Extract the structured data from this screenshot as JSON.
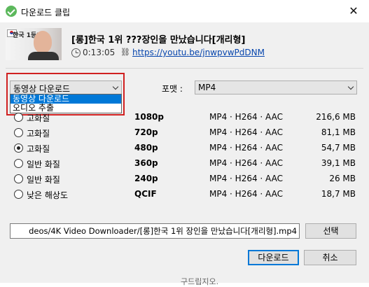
{
  "window": {
    "title": "다운로드 클립",
    "close": "✕"
  },
  "video": {
    "thumbnail_caption": "한국 1등?",
    "title": "[롱]한국 1위 ???장인을 만났습니다[개리형]",
    "duration": "0:13:05",
    "url": "https://youtu.be/jnwpvwPdDNM"
  },
  "type_select": {
    "value": "동영상 다운로드",
    "options": [
      "동영상 다운로드",
      "오디오 추출"
    ]
  },
  "format": {
    "label": "포맷 :",
    "value": "MP4"
  },
  "qualities": [
    {
      "quality": "고화질",
      "resolution": "1080p",
      "codec": "MP4 · H264 · AAC",
      "size": "216,6 MB",
      "selected": false
    },
    {
      "quality": "고화질",
      "resolution": "720p",
      "codec": "MP4 · H264 · AAC",
      "size": "81,1 MB",
      "selected": false
    },
    {
      "quality": "고화질",
      "resolution": "480p",
      "codec": "MP4 · H264 · AAC",
      "size": "54,7 MB",
      "selected": true
    },
    {
      "quality": "일반 화질",
      "resolution": "360p",
      "codec": "MP4 · H264 · AAC",
      "size": "39,1 MB",
      "selected": false
    },
    {
      "quality": "일반 화질",
      "resolution": "240p",
      "codec": "MP4 · H264 · AAC",
      "size": "26 MB",
      "selected": false
    },
    {
      "quality": "낮은 해상도",
      "resolution": "QCIF",
      "codec": "MP4 · H264 · AAC",
      "size": "18,7 MB",
      "selected": false
    }
  ],
  "save_path": "deos/4K Video Downloader/[롱]한국 1위 장인을 만났습니다[개리형].mp4",
  "buttons": {
    "browse": "선택",
    "download": "다운로드",
    "cancel": "취소"
  },
  "background_text": "구드립지오."
}
